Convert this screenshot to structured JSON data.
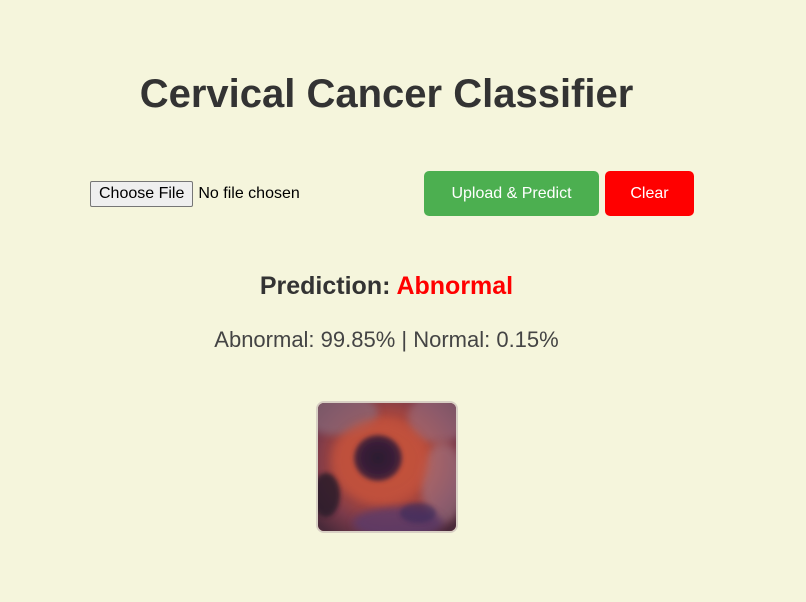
{
  "header": {
    "title": "Cervical Cancer Classifier"
  },
  "upload": {
    "choose_file_label": "Choose File",
    "file_status": "No file chosen",
    "upload_predict_label": "Upload & Predict",
    "clear_label": "Clear"
  },
  "result": {
    "prediction_label": "Prediction:",
    "prediction_value": "Abnormal",
    "probabilities": "Abnormal: 99.85% | Normal: 0.15%"
  },
  "colors": {
    "background": "#f5f5dc",
    "upload_button": "#4caf50",
    "clear_button": "#ff0000",
    "abnormal_text": "#ff0000"
  },
  "image": {
    "kind": "cell-micrograph-thumbnail"
  }
}
